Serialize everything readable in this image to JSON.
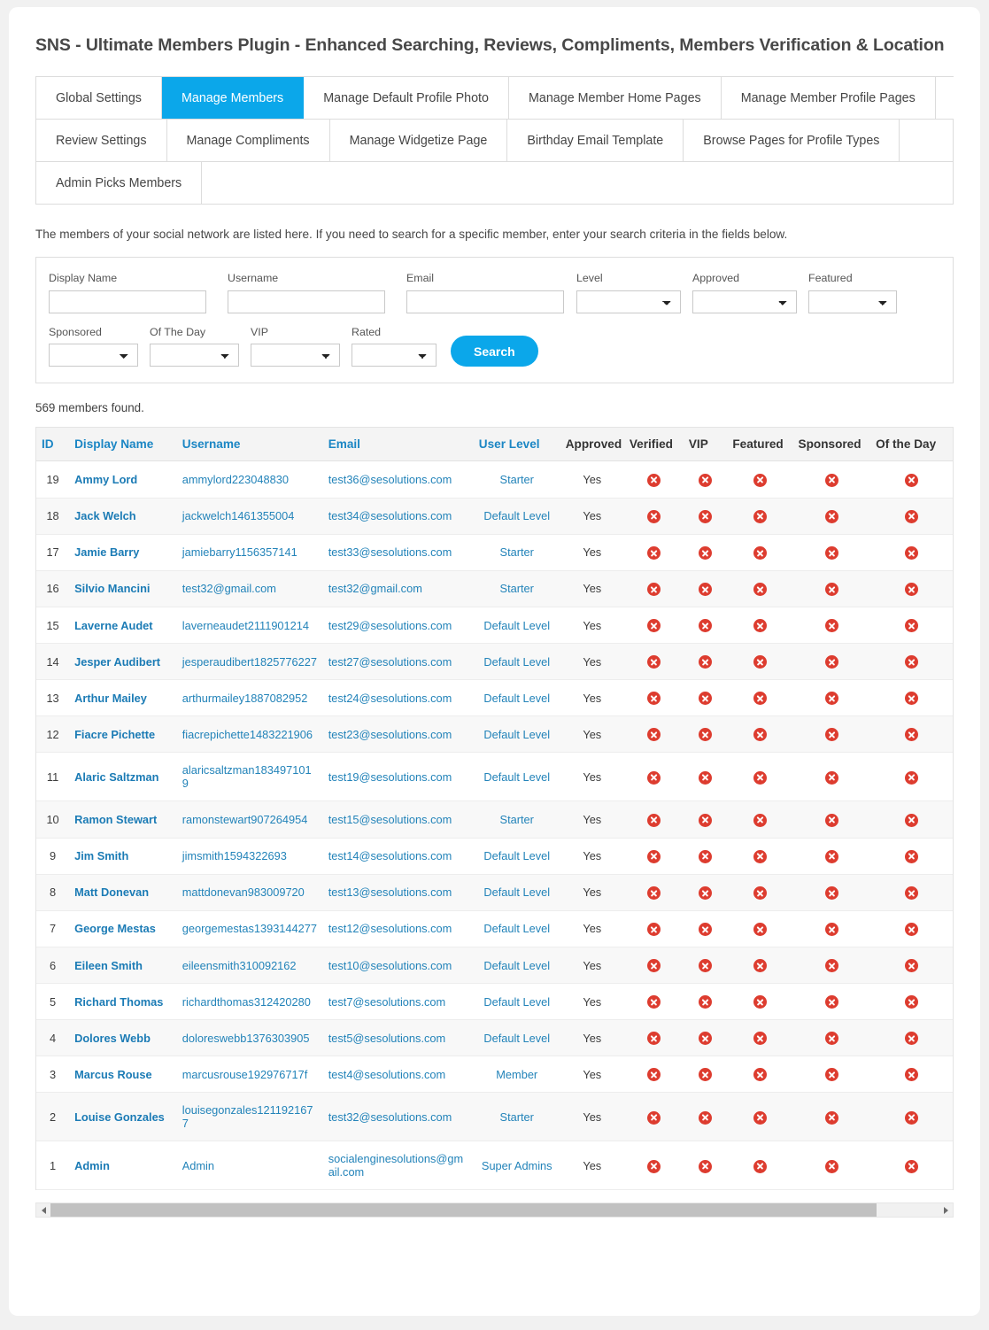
{
  "page": {
    "title": "SNS - Ultimate Members Plugin - Enhanced Searching, Reviews, Compliments, Members Verification & Location",
    "intro": "The members of your social network are listed here. If you need to search for a specific member, enter your search criteria in the fields below.",
    "results_count_text": "569 members found."
  },
  "tabs": {
    "active": "Manage Members",
    "row1": [
      "Global Settings",
      "Manage Members",
      "Manage Default Profile Photo",
      "Manage Member Home Pages",
      "Manage Member Profile Pages"
    ],
    "row2": [
      "Review Settings",
      "Manage Compliments",
      "Manage Widgetize Page",
      "Birthday Email Template",
      "Browse Pages for Profile Types"
    ],
    "row3": [
      "Admin Picks Members"
    ]
  },
  "search_form": {
    "display_name": {
      "label": "Display Name",
      "value": "",
      "placeholder": ""
    },
    "username": {
      "label": "Username",
      "value": "",
      "placeholder": ""
    },
    "email": {
      "label": "Email",
      "value": "",
      "placeholder": ""
    },
    "level": {
      "label": "Level",
      "selected": ""
    },
    "approved": {
      "label": "Approved",
      "selected": ""
    },
    "featured": {
      "label": "Featured",
      "selected": ""
    },
    "sponsored": {
      "label": "Sponsored",
      "selected": ""
    },
    "of_the_day": {
      "label": "Of The Day",
      "selected": ""
    },
    "vip": {
      "label": "VIP",
      "selected": ""
    },
    "rated": {
      "label": "Rated",
      "selected": ""
    },
    "search_button": "Search"
  },
  "table": {
    "headers": {
      "id": "ID",
      "display_name": "Display Name",
      "username": "Username",
      "email": "Email",
      "user_level": "User Level",
      "approved": "Approved",
      "verified": "Verified",
      "vip": "VIP",
      "featured": "Featured",
      "sponsored": "Sponsored",
      "of_the_day": "Of the Day"
    },
    "rows": [
      {
        "id": "19",
        "display_name": "Ammy Lord",
        "username": "ammylord223048830",
        "email": "test36@sesolutions.com",
        "user_level": "Starter",
        "approved": "Yes",
        "verified": "no",
        "vip": "no",
        "featured": "no",
        "sponsored": "no",
        "of_the_day": "no"
      },
      {
        "id": "18",
        "display_name": "Jack Welch",
        "username": "jackwelch1461355004",
        "email": "test34@sesolutions.com",
        "user_level": "Default Level",
        "approved": "Yes",
        "verified": "no",
        "vip": "no",
        "featured": "no",
        "sponsored": "no",
        "of_the_day": "no"
      },
      {
        "id": "17",
        "display_name": "Jamie Barry",
        "username": "jamiebarry1156357141",
        "email": "test33@sesolutions.com",
        "user_level": "Starter",
        "approved": "Yes",
        "verified": "no",
        "vip": "no",
        "featured": "no",
        "sponsored": "no",
        "of_the_day": "no"
      },
      {
        "id": "16",
        "display_name": "Silvio Mancini",
        "username": "test32@gmail.com",
        "email": "test32@gmail.com",
        "user_level": "Starter",
        "approved": "Yes",
        "verified": "no",
        "vip": "no",
        "featured": "no",
        "sponsored": "no",
        "of_the_day": "no"
      },
      {
        "id": "15",
        "display_name": "Laverne Audet",
        "username": "laverneaudet2111901214",
        "email": "test29@sesolutions.com",
        "user_level": "Default Level",
        "approved": "Yes",
        "verified": "no",
        "vip": "no",
        "featured": "no",
        "sponsored": "no",
        "of_the_day": "no"
      },
      {
        "id": "14",
        "display_name": "Jesper Audibert",
        "username": "jesperaudibert1825776227",
        "email": "test27@sesolutions.com",
        "user_level": "Default Level",
        "approved": "Yes",
        "verified": "no",
        "vip": "no",
        "featured": "no",
        "sponsored": "no",
        "of_the_day": "no"
      },
      {
        "id": "13",
        "display_name": "Arthur Mailey",
        "username": "arthurmailey1887082952",
        "email": "test24@sesolutions.com",
        "user_level": "Default Level",
        "approved": "Yes",
        "verified": "no",
        "vip": "no",
        "featured": "no",
        "sponsored": "no",
        "of_the_day": "no"
      },
      {
        "id": "12",
        "display_name": "Fiacre Pichette",
        "username": "fiacrepichette1483221906",
        "email": "test23@sesolutions.com",
        "user_level": "Default Level",
        "approved": "Yes",
        "verified": "no",
        "vip": "no",
        "featured": "no",
        "sponsored": "no",
        "of_the_day": "no"
      },
      {
        "id": "11",
        "display_name": "Alaric Saltzman",
        "username": "alaricsaltzman1834971019",
        "email": "test19@sesolutions.com",
        "user_level": "Default Level",
        "approved": "Yes",
        "verified": "no",
        "vip": "no",
        "featured": "no",
        "sponsored": "no",
        "of_the_day": "no"
      },
      {
        "id": "10",
        "display_name": "Ramon Stewart",
        "username": "ramonstewart907264954",
        "email": "test15@sesolutions.com",
        "user_level": "Starter",
        "approved": "Yes",
        "verified": "no",
        "vip": "no",
        "featured": "no",
        "sponsored": "no",
        "of_the_day": "no"
      },
      {
        "id": "9",
        "display_name": "Jim Smith",
        "username": "jimsmith1594322693",
        "email": "test14@sesolutions.com",
        "user_level": "Default Level",
        "approved": "Yes",
        "verified": "no",
        "vip": "no",
        "featured": "no",
        "sponsored": "no",
        "of_the_day": "no"
      },
      {
        "id": "8",
        "display_name": "Matt Donevan",
        "username": "mattdonevan983009720",
        "email": "test13@sesolutions.com",
        "user_level": "Default Level",
        "approved": "Yes",
        "verified": "no",
        "vip": "no",
        "featured": "no",
        "sponsored": "no",
        "of_the_day": "no"
      },
      {
        "id": "7",
        "display_name": "George Mestas",
        "username": "georgemestas1393144277",
        "email": "test12@sesolutions.com",
        "user_level": "Default Level",
        "approved": "Yes",
        "verified": "no",
        "vip": "no",
        "featured": "no",
        "sponsored": "no",
        "of_the_day": "no"
      },
      {
        "id": "6",
        "display_name": "Eileen Smith",
        "username": "eileensmith310092162",
        "email": "test10@sesolutions.com",
        "user_level": "Default Level",
        "approved": "Yes",
        "verified": "no",
        "vip": "no",
        "featured": "no",
        "sponsored": "no",
        "of_the_day": "no"
      },
      {
        "id": "5",
        "display_name": "Richard Thomas",
        "username": "richardthomas312420280",
        "email": "test7@sesolutions.com",
        "user_level": "Default Level",
        "approved": "Yes",
        "verified": "no",
        "vip": "no",
        "featured": "no",
        "sponsored": "no",
        "of_the_day": "no"
      },
      {
        "id": "4",
        "display_name": "Dolores Webb",
        "username": "doloreswebb1376303905",
        "email": "test5@sesolutions.com",
        "user_level": "Default Level",
        "approved": "Yes",
        "verified": "no",
        "vip": "no",
        "featured": "no",
        "sponsored": "no",
        "of_the_day": "no"
      },
      {
        "id": "3",
        "display_name": "Marcus Rouse",
        "username": "marcusrouse192976717f",
        "email": "test4@sesolutions.com",
        "user_level": "Member",
        "approved": "Yes",
        "verified": "no",
        "vip": "no",
        "featured": "no",
        "sponsored": "no",
        "of_the_day": "no"
      },
      {
        "id": "2",
        "display_name": "Louise Gonzales",
        "username": "louisegonzales1211921677",
        "email": "test32@sesolutions.com",
        "user_level": "Starter",
        "approved": "Yes",
        "verified": "no",
        "vip": "no",
        "featured": "no",
        "sponsored": "no",
        "of_the_day": "no"
      },
      {
        "id": "1",
        "display_name": "Admin",
        "username": "Admin",
        "email": "socialenginesolutions@gmail.com",
        "user_level": "Super Admins",
        "approved": "Yes",
        "verified": "no",
        "vip": "no",
        "featured": "no",
        "sponsored": "no",
        "of_the_day": "no"
      }
    ]
  },
  "scrollbar": {
    "left_arrow_icon": "chevron-left-icon",
    "right_arrow_icon": "chevron-right-icon",
    "thumb_percent": 93
  },
  "colors": {
    "accent_blue": "#0ba7ea",
    "link_blue": "#2283b9",
    "status_red": "#dd3c2f",
    "page_bg": "#f1f1f1"
  }
}
